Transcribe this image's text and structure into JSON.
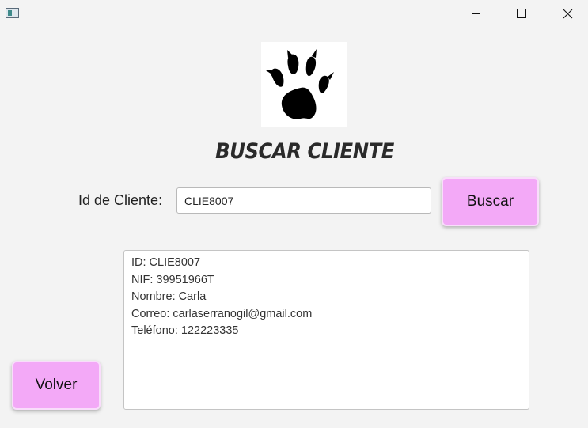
{
  "window": {
    "title": "",
    "icons": {
      "app": "app-window-icon",
      "minimize": "minimize-icon",
      "maximize": "maximize-icon",
      "close": "close-icon"
    }
  },
  "logo": {
    "icon": "paw-print-icon",
    "color": "#000000"
  },
  "heading": "BUSCAR CLIENTE",
  "search": {
    "label": "Id de Cliente:",
    "value": "CLIE8007",
    "button_label": "Buscar"
  },
  "result": {
    "lines": [
      "ID: CLIE8007",
      "NIF: 39951966T",
      "Nombre: Carla",
      "Correo: carlaserranogil@gmail.com",
      "Teléfono: 122223335"
    ]
  },
  "back_button_label": "Volver",
  "colors": {
    "button_bg": "#f3a9f7",
    "window_bg": "#f3f3f3"
  }
}
